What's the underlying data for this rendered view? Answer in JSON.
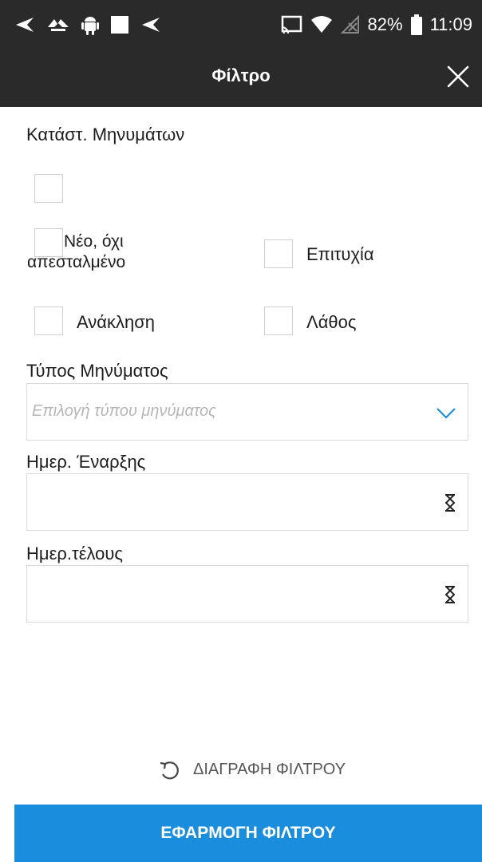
{
  "status_bar": {
    "battery_percent": "82%",
    "time": "11:09",
    "icons": [
      "navigation-arrow-icon",
      "linked-app-icon",
      "android-icon",
      "white-square-icon",
      "navigation-arrow-icon",
      "cast-icon",
      "wifi-icon",
      "no-signal-icon",
      "battery-icon"
    ]
  },
  "appbar": {
    "title": "Φίλτρο",
    "close_icon": "close-icon"
  },
  "message_status": {
    "label": "Κατάστ. Μηνυμάτων",
    "options": [
      {
        "label": ""
      },
      {
        "label": "Νέο, όχι απεσταλμένο"
      },
      {
        "label": "Επιτυχία"
      },
      {
        "label": "Ανάκληση"
      },
      {
        "label": "Λάθος"
      }
    ]
  },
  "message_type": {
    "label": "Τύπος Μηνύματος",
    "placeholder": "Επιλογή τύπου μηνύματος",
    "icon": "chevron-down-icon"
  },
  "start_date": {
    "label": "Ημερ. Έναρξης",
    "value": "",
    "icon": "hourglass-icon"
  },
  "end_date": {
    "label": "Ημερ.τέλους",
    "value": "",
    "icon": "hourglass-icon"
  },
  "actions": {
    "reset_label": "ΔΙΑΓΡΑΦΗ ΦΙΛΤΡΟΥ",
    "reset_icon": "undo-icon",
    "apply_label": "ΕΦΑΡΜΟΓΗ ΦΙΛΤΡΟΥ"
  },
  "colors": {
    "appbar": "#2a2a2a",
    "apply_button": "#1a8ddc",
    "chevron": "#1a8ddc"
  }
}
